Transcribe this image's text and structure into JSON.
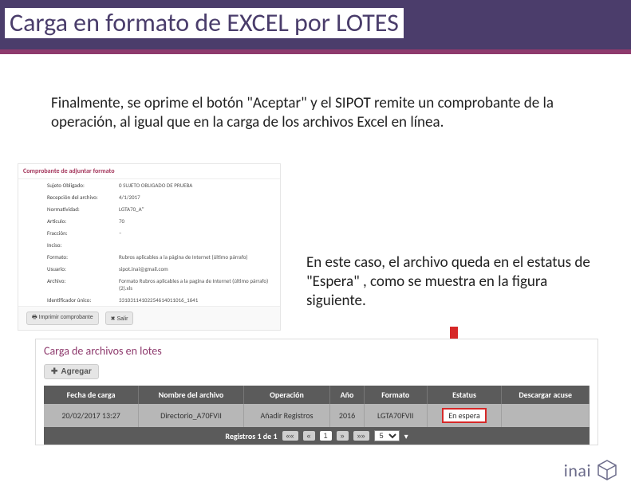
{
  "title": "Carga en formato de EXCEL por LOTES",
  "para1": "Finalmente, se oprime el botón  \"Aceptar\"  y el SIPOT remite un comprobante de la operación, al igual que en la carga de los archivos Excel en línea.",
  "para2": "En este caso, el archivo queda en el estatus de  \"Espera\" , como se muestra en la figura siguiente.",
  "comprobante": {
    "title": "Comprobante de adjuntar formato",
    "rows": [
      {
        "k": "Sujeto Obligado:",
        "v": "0 SUJETO OBLIGADO DE PRUEBA"
      },
      {
        "k": "Recepción del archivo:",
        "v": "4/1/2017"
      },
      {
        "k": "Normatividad:",
        "v": "LGTA70_A\""
      },
      {
        "k": "Artículo:",
        "v": "70"
      },
      {
        "k": "Fracción:",
        "v": "–"
      },
      {
        "k": "Inciso:",
        "v": ""
      },
      {
        "k": "Formato:",
        "v": "Rubros aplicables a la página de Internet (último párrafo)"
      },
      {
        "k": "Usuario:",
        "v": "sipot.inai@gmail.com"
      },
      {
        "k": "Archivo:",
        "v": "Formato Rubros aplicables a la pagina de Internet (último párrafo) (2).xls"
      },
      {
        "k": "Identificador único:",
        "v": "33103114102254614011016_1641"
      }
    ],
    "btn_print": "Imprimir comprobante",
    "btn_exit": "Salir"
  },
  "lotes": {
    "title": "Carga de archivos en lotes",
    "agregar": "Agregar",
    "headers": [
      "Fecha de carga",
      "Nombre del archivo",
      "Operación",
      "Año",
      "Formato",
      "Estatus",
      "Descargar acuse"
    ],
    "row": {
      "fecha": "20/02/2017 13:27",
      "nombre": "Directorio_A70FVII",
      "operacion": "Añadir Registros",
      "anio": "2016",
      "formato": "LGTA70FVII",
      "estatus": "En espera",
      "acuse": ""
    },
    "paginator": {
      "label": "Registros 1 de 1",
      "first": "««",
      "prev": "«",
      "page": "1",
      "next": "»",
      "last": "»»",
      "size": "5"
    }
  },
  "logo": "inai"
}
